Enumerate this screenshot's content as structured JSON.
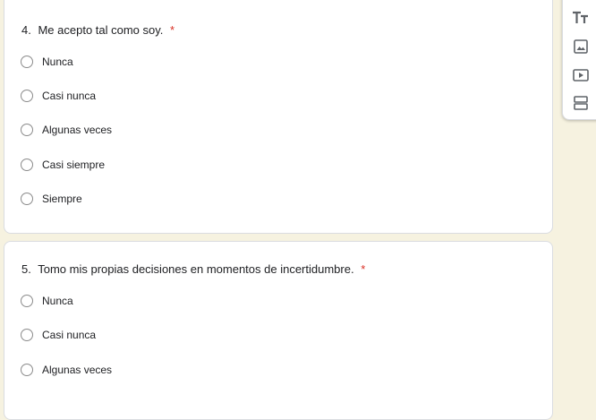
{
  "questions": [
    {
      "number": "4.",
      "text": "Me acepto tal como soy.",
      "required_mark": "*",
      "options": [
        "Nunca",
        "Casi nunca",
        "Algunas veces",
        "Casi siempre",
        "Siempre"
      ]
    },
    {
      "number": "5.",
      "text": "Tomo mis propias decisiones en momentos de incertidumbre.",
      "required_mark": "*",
      "options": [
        "Nunca",
        "Casi nunca",
        "Algunas veces"
      ]
    }
  ],
  "toolbar": {
    "icons": [
      "add-title-icon",
      "add-image-icon",
      "add-video-icon",
      "add-section-icon"
    ]
  },
  "colors": {
    "background": "#f6f2e0",
    "required": "#d93025",
    "icon": "#5f6368"
  }
}
